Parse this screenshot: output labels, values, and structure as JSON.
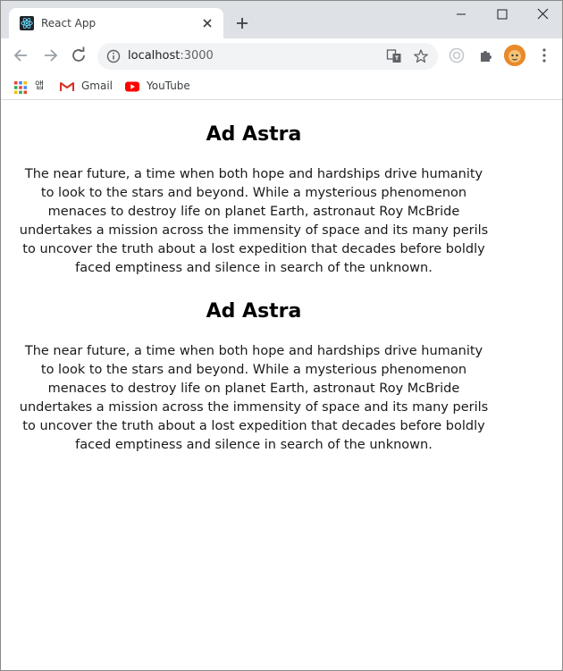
{
  "browser": {
    "tab_title": "React App",
    "url_host": "localhost",
    "url_port": ":3000",
    "bookmarks": {
      "app2_label": "앱",
      "gmail": "Gmail",
      "youtube": "YouTube"
    }
  },
  "colors": {
    "react_blue": "#61dafb",
    "gmail_red": "#d93025",
    "youtube_red": "#ff0000"
  },
  "articles": [
    {
      "title": "Ad Astra",
      "body": "The near future, a time when both hope and hardships drive humanity to look to the stars and beyond. While a mysterious phenomenon menaces to destroy life on planet Earth, astronaut Roy McBride undertakes a mission across the immensity of space and its many perils to uncover the truth about a lost expedition that decades before boldly faced emptiness and silence in search of the unknown."
    },
    {
      "title": "Ad Astra",
      "body": "The near future, a time when both hope and hardships drive humanity to look to the stars and beyond. While a mysterious phenomenon menaces to destroy life on planet Earth, astronaut Roy McBride undertakes a mission across the immensity of space and its many perils to uncover the truth about a lost expedition that decades before boldly faced emptiness and silence in search of the unknown."
    }
  ]
}
